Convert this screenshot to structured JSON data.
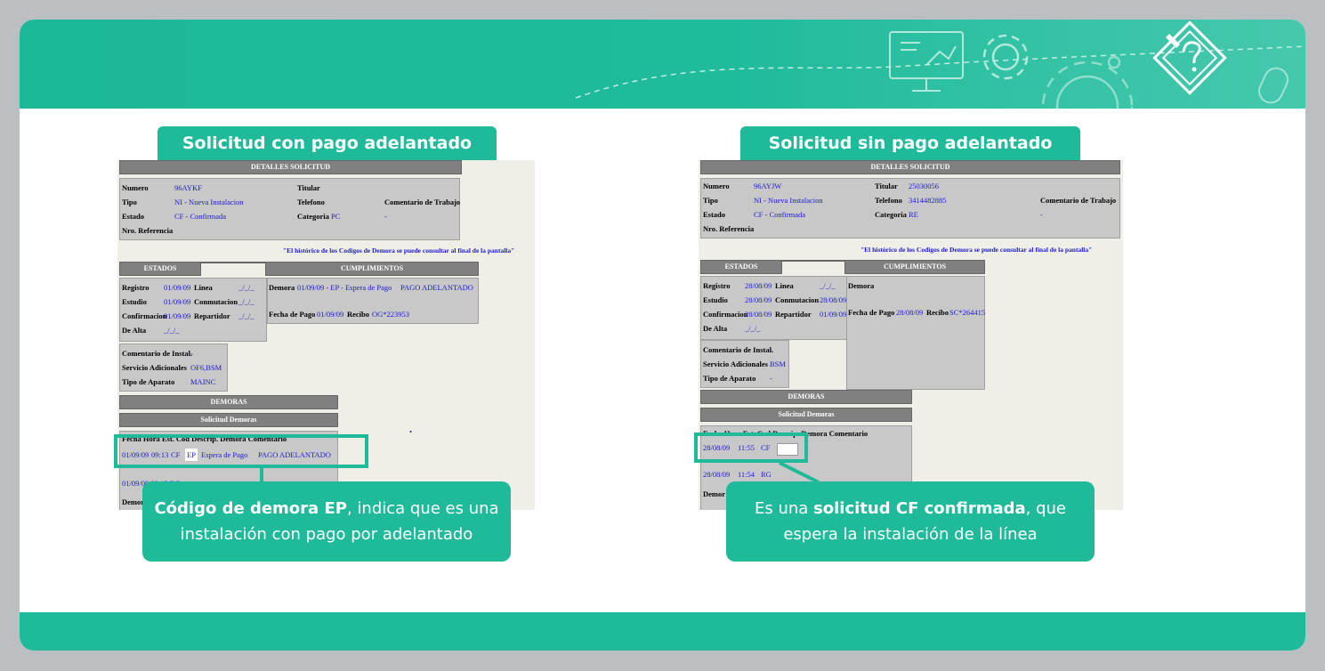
{
  "colors": {
    "accent": "#1fba9a",
    "background": "#bcbfc2",
    "link_value": "#1a1acd"
  },
  "icons": [
    "monitor-presentation-icon",
    "gear-icon",
    "large-gear-icon",
    "mouse-icon",
    "pencil-question-badge-icon"
  ],
  "left": {
    "title": "Solicitud con pago adelantado",
    "detalles_header": "DETALLES SOLICITUD",
    "numero_label": "Numero",
    "numero_value": "96AYKF",
    "tipo_label": "Tipo",
    "tipo_value": "NI - Nueva Instalacion",
    "estado_label": "Estado",
    "estado_value": "CF - Confirmada",
    "nro_ref_label": "Nro. Referencia",
    "titular_label": "Titular",
    "telefono_label": "Telefono",
    "categoria_label": "Categoria",
    "categoria_value": "PC",
    "comentario_trabajo_label": "Comentario de Trabajo",
    "comentario_trabajo_value": "-",
    "historico_note": "\"El histórico de los Codigos de Demora se puede consultar al final de la pantalla\"",
    "estados_header": "ESTADOS",
    "cumplimientos_header": "CUMPLIMIENTOS",
    "registro_label": "Registro",
    "registro_value": "01/09/09",
    "linea_label": "Linea",
    "linea_value": "_/_/_",
    "estudio_label": "Estudio",
    "estudio_value": "01/09/09",
    "conmutacion_label": "Conmutacion",
    "conmutacion_value": "_/_/_",
    "confirmacion_label": "Confirmacion",
    "confirmacion_value": "01/09/09",
    "repartidor_label": "Repartidor",
    "repartidor_value": "_/_/_",
    "de_alta_label": "De Alta",
    "de_alta_value": "_/_/_",
    "demora_label": "Demora",
    "demora_value": "01/09/09 - EP - Espera de Pago",
    "demora_status": "PAGO ADELANTADO",
    "fecha_pago_label": "Fecha de Pago",
    "fecha_pago_value": "01/09/09",
    "recibo_label": "Recibo",
    "recibo_value": "OG*223953",
    "comentario_instal_label": "Comentario de Instal.",
    "comentario_instal_value": "-",
    "servicio_label": "Servicio Adicionales",
    "servicio_value": "OF6,BSM",
    "tipo_aparato_label": "Tipo de Aparato",
    "tipo_aparato_value": "MAINC",
    "demoras_header": "DEMORAS",
    "solicitud_demoras_header": "Solicitud Demoras",
    "demoras_columns": "Fecha    Hora  Est. Cod Descrip. Demora  Comentario",
    "row1": {
      "fecha": "01/09/09",
      "hora": "09:13",
      "est": "CF",
      "cod": "EP",
      "descrip": "Espera de Pago",
      "comentario": "PAGO ADELANTADO"
    },
    "row2_partial": "01/09/09  09:13  RG",
    "demora_bottom_label": "Demor",
    "callout_bold": "Código de demora EP",
    "callout_text": ", indica que es una instalación con pago por adelantado"
  },
  "right": {
    "title": "Solicitud sin pago adelantado",
    "detalles_header": "DETALLES SOLICITUD",
    "numero_label": "Numero",
    "numero_value": "96AYJW",
    "tipo_label": "Tipo",
    "tipo_value": "NI - Nueva Instalacion",
    "estado_label": "Estado",
    "estado_value": "CF - Confirmada",
    "nro_ref_label": "Nro. Referencia",
    "titular_label": "Titular",
    "titular_value": "25030056",
    "telefono_label": "Telefono",
    "telefono_value": "3414482885",
    "categoria_label": "Categoria",
    "categoria_value": "RE",
    "comentario_trabajo_label": "Comentario de Trabajo",
    "comentario_trabajo_value": "-",
    "historico_note": "\"El histórico de los Codigos de Demora se puede consultar al final de la pantalla\"",
    "estados_header": "ESTADOS",
    "cumplimientos_header": "CUMPLIMIENTOS",
    "registro_label": "Registro",
    "registro_value": "28/08/09",
    "linea_label": "Linea",
    "linea_value": "_/_/_",
    "estudio_label": "Estudio",
    "estudio_value": "28/08/09",
    "conmutacion_label": "Conmutacion",
    "conmutacion_value": "28/08/09",
    "confirmacion_label": "Confirmacion",
    "confirmacion_value": "28/08/09",
    "repartidor_label": "Repartidor",
    "repartidor_value": "01/09/09",
    "de_alta_label": "De Alta",
    "de_alta_value": "_/_/_",
    "demora_label": "Demora",
    "fecha_pago_label": "Fecha de Pago",
    "fecha_pago_value": "28/08/09",
    "recibo_label": "Recibo",
    "recibo_value": "SC*264415",
    "comentario_instal_label": "Comentario de Instal.",
    "comentario_instal_value": "-",
    "servicio_label": "Servicio Adicionales",
    "servicio_value": "BSM",
    "tipo_aparato_label": "Tipo de Aparato",
    "tipo_aparato_value": "-",
    "demoras_header": "DEMORAS",
    "solicitud_demoras_header": "Solicitud Demoras",
    "demoras_columns": "Fecha    Hora  Est. Cod  Descrip. Demora    Comentario",
    "row1": {
      "fecha": "28/08/09",
      "hora": "11:55",
      "est": "CF"
    },
    "row2": {
      "fecha": "28/08/09",
      "hora": "11:54",
      "est": "RG"
    },
    "demora_bottom_label": "Demor",
    "callout_pre": "Es una ",
    "callout_bold": "solicitud CF confirmada",
    "callout_text": ", que espera la instalación de la línea"
  }
}
